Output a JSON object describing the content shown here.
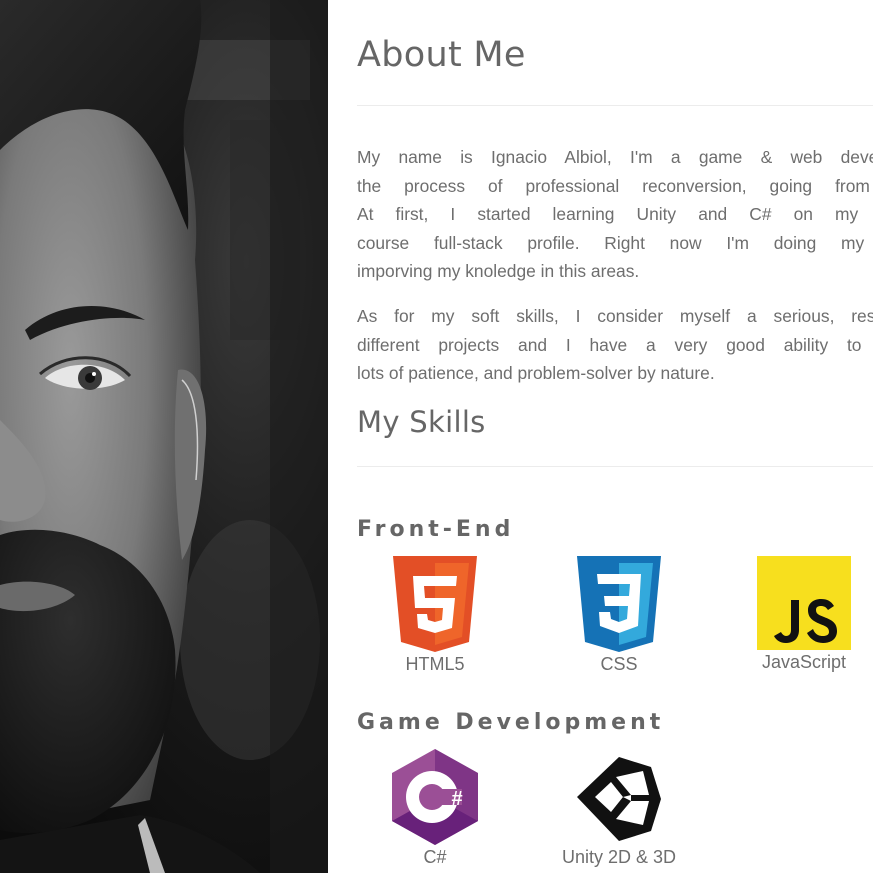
{
  "about": {
    "title": "About Me",
    "paragraph1_lines": [
      "My name is Ignacio Albiol, I'm a game & web developer",
      "the process of professional reconversion, going from the",
      "At first, I started learning Unity and C# on my own,",
      "course full-stack profile. Right now I'm doing my first",
      "imporving my knoledge in this areas."
    ],
    "paragraph2_lines": [
      "As for my soft skills, I consider myself a serious, responsi",
      "different projects and I have a very good ability to work",
      "lots of patience, and problem-solver by nature."
    ]
  },
  "skills": {
    "title": "My Skills",
    "front_end": {
      "heading": "Front-End",
      "items": [
        {
          "label": "HTML5",
          "icon": "html5-icon",
          "color": "#e34f26"
        },
        {
          "label": "CSS",
          "icon": "css3-icon",
          "color": "#1572b6"
        },
        {
          "label": "JavaScript",
          "icon": "javascript-icon",
          "color": "#f7df1e"
        }
      ]
    },
    "game_development": {
      "heading": "Game Development",
      "items": [
        {
          "label": "C#",
          "icon": "csharp-icon",
          "color": "#68217a"
        },
        {
          "label": "Unity 2D & 3D",
          "icon": "unity-icon",
          "color": "#000000"
        }
      ]
    }
  },
  "colors": {
    "heading_text": "#666666",
    "body_text": "#6e6e6e",
    "divider": "#ececec"
  }
}
